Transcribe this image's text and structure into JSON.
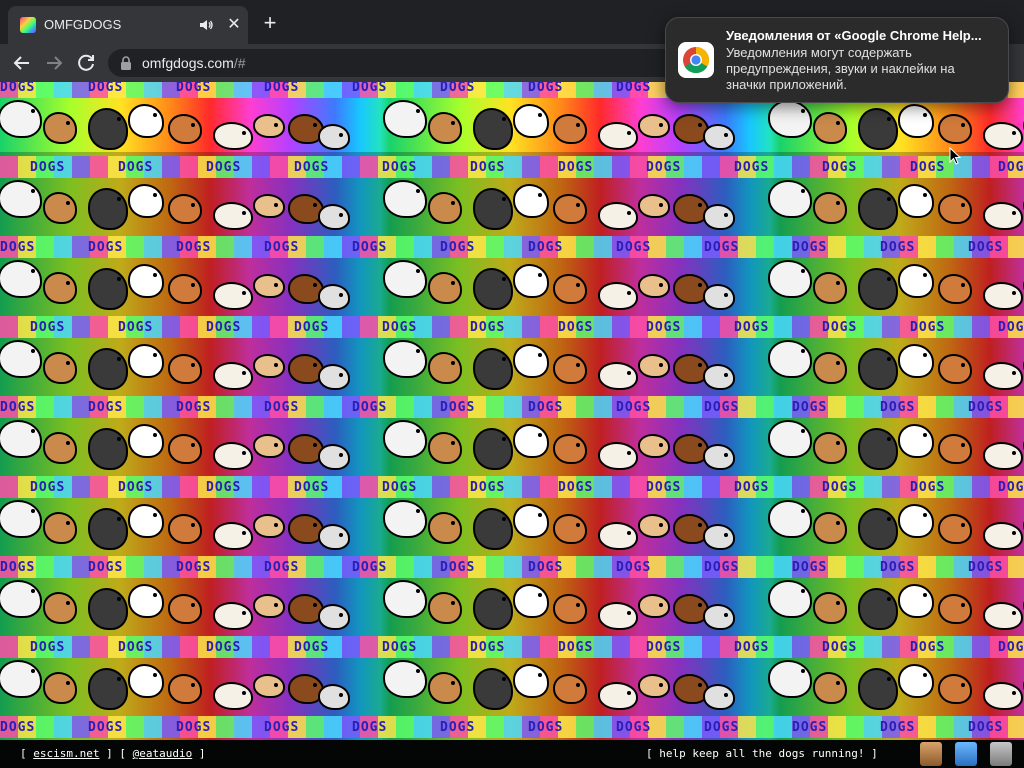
{
  "browser": {
    "tab": {
      "title": "OMFGDOGS",
      "close_glyph": "✕"
    },
    "new_tab_glyph": "+",
    "address": {
      "host": "omfgdogs.com",
      "path": "/#"
    }
  },
  "page": {
    "word": "DOGS",
    "footer": {
      "open_bracket": "[",
      "close_bracket": "]",
      "link1": "escism.net",
      "link2": "@eataudio",
      "right_text": "[ help keep all the dogs running! ]"
    }
  },
  "notification": {
    "title": "Уведомления от «Google Chrome Help...",
    "body": "Уведомления могут содержать предупреждения, звуки и наклейки на значки приложений."
  },
  "icons": {
    "favicon": "rainbow-dogs-favicon",
    "audio": "speaker-icon",
    "back": "arrow-left-icon",
    "forward": "arrow-right-icon",
    "reload": "reload-icon",
    "lock": "lock-icon",
    "notification": "chrome-logo-icon"
  },
  "colors": {
    "tab_bg": "#35363a",
    "frame_bg": "#202124",
    "notification_bg": "#2b2b2c"
  }
}
